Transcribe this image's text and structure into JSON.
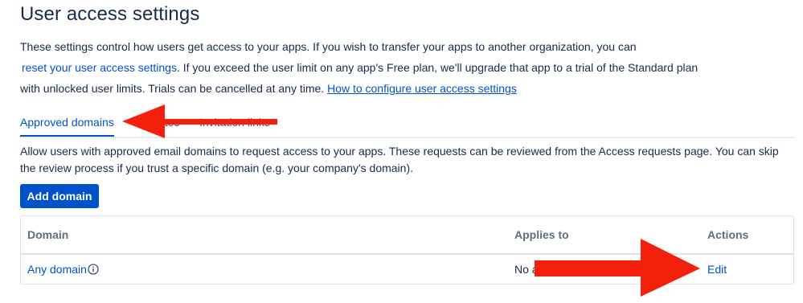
{
  "header": {
    "title": "User access settings"
  },
  "intro": {
    "line1": "These settings control how users get access to your apps. If you wish to transfer your apps to another organization, you can",
    "reset_link": "reset your user access settings",
    "line2_rest": ". If you exceed the user limit on any app's Free plan, we'll upgrade that app to a trial of the Standard plan",
    "line3": "with unlocked user limits. Trials can be cancelled at any time.",
    "howto_link": "How to configure user access settings"
  },
  "tabs": [
    {
      "label": "Approved domains",
      "active": true
    },
    {
      "label": "Invites",
      "active": false
    },
    {
      "label": "Invitation links",
      "active": false
    }
  ],
  "description": "Allow users with approved email domains to request access to your apps. These requests can be reviewed from the Access requests page. You can skip the review process if you trust a specific domain (e.g. your company's domain).",
  "add_button": "Add domain",
  "table": {
    "columns": [
      "Domain",
      "Applies to",
      "Actions"
    ],
    "rows": [
      {
        "domain": "Any domain",
        "applies_to": "No apps",
        "action": "Edit"
      }
    ]
  },
  "colors": {
    "accent": "#0052cc",
    "text": "#172b4d",
    "annotation_arrow": "#f5200b"
  },
  "icons": {
    "domain_info": "info-icon"
  }
}
